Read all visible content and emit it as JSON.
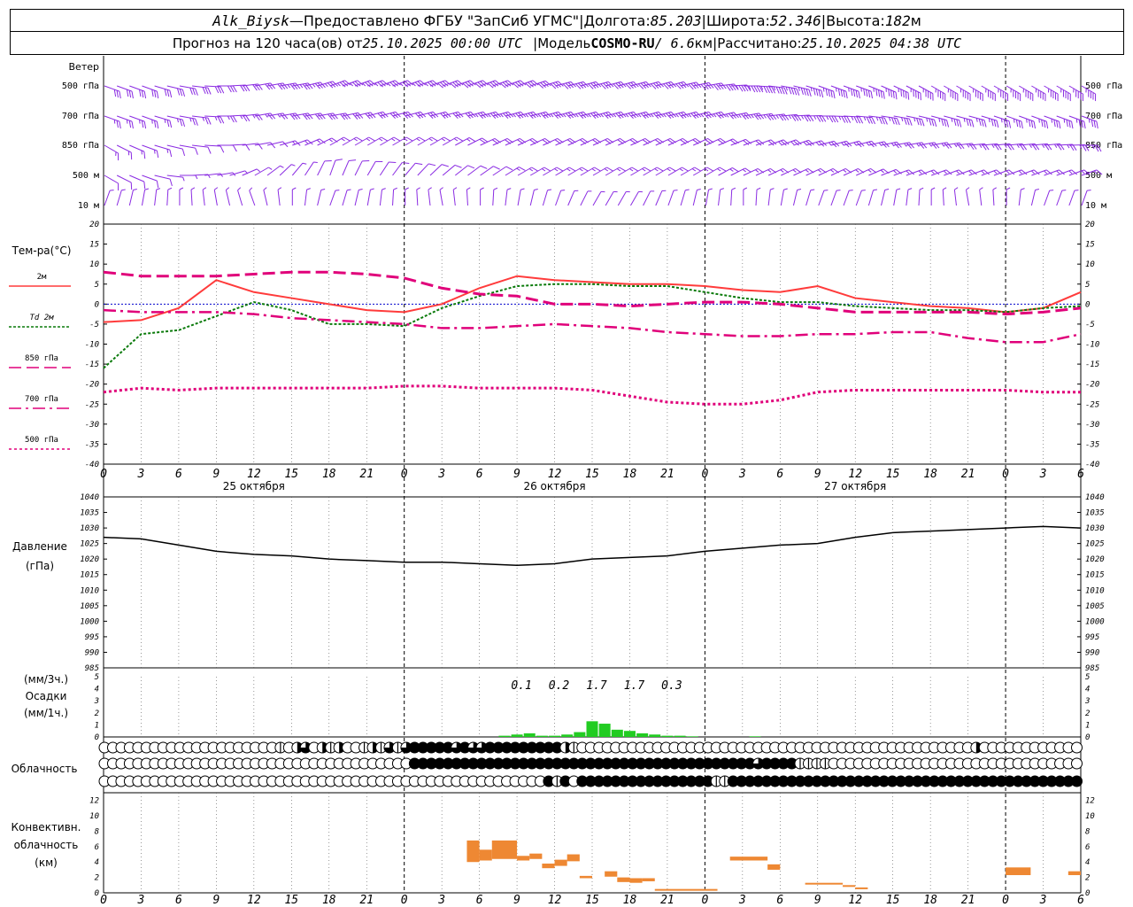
{
  "header": {
    "station": "Alk_Biysk",
    "dash": " — ",
    "provided": "Предоставлено ФГБУ \"ЗапСиб УГМС\"",
    "sep": " | ",
    "lon_label": "Долгота: ",
    "lon": "85.203",
    "lat_label": "Широта: ",
    "lat": "52.346",
    "alt_label": "Высота: ",
    "alt": "182",
    "alt_unit": "м",
    "forecast_label": "Прогноз на 120 часа(ов) от ",
    "forecast_start": "25.10.2025 00:00 UTC",
    "model_label": "Модель ",
    "model": "COSMO-RU",
    "model_res": " / 6.6",
    "model_res_unit": "км",
    "calc_label": "Рассчитано: ",
    "calc_time": "25.10.2025 04:38 UTC"
  },
  "colors": {
    "wind": "#8a2be2",
    "t2m": "#ff3b3b",
    "td2m": "#0a7a0a",
    "t850": "#e0007a",
    "t700": "#e0007a",
    "t500": "#e0007a",
    "zero": "#0000cc",
    "pressure": "#000000",
    "precip": "#22cc22",
    "conv": "#ee8833"
  },
  "panels": {
    "wind": {
      "title": "Ветер",
      "levels": [
        "500 гПа",
        "700 гПа",
        "850 гПа",
        "500 м",
        "10 м"
      ]
    },
    "temp": {
      "title": "Тем-ра(°C)",
      "legend": [
        "2м",
        "Td 2м",
        "850 гПа",
        "700 гПа",
        "500 гПа"
      ],
      "yticks": [
        "20",
        "15",
        "10",
        "5",
        "0",
        "-5",
        "-10",
        "-15",
        "-20",
        "-25",
        "-30",
        "-35",
        "-40"
      ]
    },
    "pressure": {
      "title1": "Давление",
      "title2": "(гПа)",
      "yticks": [
        "1040",
        "1035",
        "1030",
        "1025",
        "1020",
        "1015",
        "1010",
        "1005",
        "1000",
        "995",
        "990",
        "985"
      ]
    },
    "precip": {
      "title1": "(мм/3ч.)",
      "title2": "Осадки",
      "title3": "(мм/1ч.)",
      "yticks": [
        "5",
        "4",
        "3",
        "2",
        "1",
        "0"
      ],
      "sums": [
        "0.1",
        "0.2",
        "1.7",
        "1.7",
        "0.3"
      ]
    },
    "cloud": {
      "title": "Облачность"
    },
    "conv": {
      "title1": "Конвективн.",
      "title2": "облачность",
      "title3": "(км)",
      "yticks": [
        "12",
        "10",
        "8",
        "6",
        "4",
        "2",
        "0"
      ]
    },
    "hour_ticks": [
      "0",
      "3",
      "6",
      "9",
      "12",
      "15",
      "18",
      "21",
      "0",
      "3",
      "6",
      "9",
      "12",
      "15",
      "18",
      "21",
      "0",
      "3",
      "6",
      "9",
      "12",
      "15",
      "18",
      "21",
      "0",
      "3",
      "6"
    ],
    "dates": [
      "25 октября",
      "26 октября",
      "27 октября"
    ]
  },
  "chart_data": [
    {
      "type": "line",
      "title": "Тем-ра(°C)",
      "ylim": [
        -40,
        20
      ],
      "x_hours": [
        0,
        3,
        6,
        9,
        12,
        15,
        18,
        21,
        24,
        27,
        30,
        33,
        36,
        39,
        42,
        45,
        48,
        51,
        54,
        57,
        60,
        63,
        66,
        69,
        72,
        75,
        78
      ],
      "series": [
        {
          "name": "2м",
          "values": [
            -4.5,
            -4,
            -1,
            6,
            3,
            1.5,
            0,
            -1.5,
            -2,
            0,
            4,
            7,
            6,
            5.5,
            5,
            5,
            4.5,
            3.5,
            3,
            4.5,
            1.5,
            0.5,
            -0.5,
            -1,
            -2,
            -1,
            3
          ]
        },
        {
          "name": "Td 2м",
          "values": [
            -16,
            -7.5,
            -6.5,
            -3,
            0.5,
            -1.5,
            -5,
            -5,
            -5.5,
            -1,
            2,
            4.5,
            5,
            5,
            4.5,
            4.5,
            3,
            1.5,
            0.5,
            0.5,
            -0.5,
            -1,
            -1.5,
            -1.5,
            -2,
            -1,
            -0.5
          ]
        },
        {
          "name": "850 гПа",
          "values": [
            8,
            7,
            7,
            7,
            7.5,
            8,
            8,
            7.5,
            6.5,
            4,
            2.5,
            2,
            0,
            0,
            -0.5,
            0,
            0.5,
            0.5,
            0,
            -1,
            -2,
            -2,
            -2,
            -2,
            -2.5,
            -2,
            -1
          ]
        },
        {
          "name": "700 гПа",
          "values": [
            -1.5,
            -2,
            -2,
            -2,
            -2.5,
            -3.5,
            -4,
            -4.5,
            -5,
            -6,
            -6,
            -5.5,
            -5,
            -5.5,
            -6,
            -7,
            -7.5,
            -8,
            -8,
            -7.5,
            -7.5,
            -7,
            -7,
            -8.5,
            -9.5,
            -9.5,
            -7.5
          ]
        },
        {
          "name": "500 гПа",
          "values": [
            -22,
            -21,
            -21.5,
            -21,
            -21,
            -21,
            -21,
            -21,
            -20.5,
            -20.5,
            -21,
            -21,
            -21,
            -21.5,
            -23,
            -24.5,
            -25,
            -25,
            -24,
            -22,
            -21.5,
            -21.5,
            -21.5,
            -21.5,
            -21.5,
            -22,
            -22
          ]
        }
      ]
    },
    {
      "type": "line",
      "title": "Давление",
      "ylabel": "(гПа)",
      "ylim": [
        985,
        1040
      ],
      "x_hours": [
        0,
        3,
        6,
        9,
        12,
        15,
        18,
        21,
        24,
        27,
        30,
        33,
        36,
        39,
        42,
        45,
        48,
        51,
        54,
        57,
        60,
        63,
        66,
        69,
        72,
        75,
        78
      ],
      "series": [
        {
          "name": "Давление",
          "values": [
            1027,
            1026.5,
            1024.5,
            1022.5,
            1021.5,
            1021,
            1020,
            1019.5,
            1019,
            1019,
            1018.5,
            1018,
            1018.5,
            1020,
            1020.5,
            1021,
            1022.5,
            1023.5,
            1024.5,
            1025,
            1027,
            1028.5,
            1029,
            1029.5,
            1030,
            1030.5,
            1030
          ]
        }
      ]
    },
    {
      "type": "bar",
      "title": "Осадки",
      "ylabel": "(мм/1ч.)",
      "ylim": [
        0,
        5
      ],
      "x_hours": [
        32,
        33,
        34,
        35,
        36,
        37,
        38,
        39,
        40,
        41,
        42,
        43,
        44,
        45,
        46,
        47,
        52
      ],
      "values": [
        0.1,
        0.2,
        0.3,
        0.1,
        0.1,
        0.2,
        0.4,
        1.3,
        1.1,
        0.6,
        0.5,
        0.3,
        0.2,
        0.1,
        0.1,
        0.05,
        0.05
      ]
    },
    {
      "type": "bar",
      "title": "Конвективн. облачность",
      "ylabel": "(км)",
      "ylim": [
        0,
        12
      ],
      "segments": [
        {
          "x0": 29,
          "x1": 30,
          "base": 4,
          "top": 6.8
        },
        {
          "x0": 30,
          "x1": 31,
          "base": 4.2,
          "top": 5.6
        },
        {
          "x0": 31,
          "x1": 33,
          "base": 4.4,
          "top": 6.8
        },
        {
          "x0": 33,
          "x1": 34,
          "base": 4.2,
          "top": 4.8
        },
        {
          "x0": 34,
          "x1": 35,
          "base": 4.4,
          "top": 5.1
        },
        {
          "x0": 35,
          "x1": 36,
          "base": 3.2,
          "top": 3.8
        },
        {
          "x0": 36,
          "x1": 37,
          "base": 3.5,
          "top": 4.3
        },
        {
          "x0": 37,
          "x1": 38,
          "base": 4.1,
          "top": 5
        },
        {
          "x0": 38,
          "x1": 39,
          "base": 1.9,
          "top": 2.2
        },
        {
          "x0": 40,
          "x1": 41,
          "base": 2.1,
          "top": 2.8
        },
        {
          "x0": 41,
          "x1": 42,
          "base": 1.4,
          "top": 2
        },
        {
          "x0": 42,
          "x1": 43,
          "base": 1.3,
          "top": 1.9
        },
        {
          "x0": 43,
          "x1": 44,
          "base": 1.5,
          "top": 1.9
        },
        {
          "x0": 44,
          "x1": 49,
          "base": 0.3,
          "top": 0.5
        },
        {
          "x0": 50,
          "x1": 53,
          "base": 4.2,
          "top": 4.7
        },
        {
          "x0": 53,
          "x1": 54,
          "base": 3,
          "top": 3.7
        },
        {
          "x0": 56,
          "x1": 59,
          "base": 1.1,
          "top": 1.3
        },
        {
          "x0": 59,
          "x1": 60,
          "base": 0.8,
          "top": 1
        },
        {
          "x0": 60,
          "x1": 61,
          "base": 0.5,
          "top": 0.7
        },
        {
          "x0": 72,
          "x1": 74,
          "base": 2.3,
          "top": 3.3
        },
        {
          "x0": 77,
          "x1": 78,
          "base": 2.3,
          "top": 2.8
        }
      ]
    },
    {
      "type": "table",
      "title": "Облачность",
      "note": "cover codes 0..4 per hour (0=clear, 4=overcast), rows: upper, middle, lower",
      "rows": [
        "000000000000000000000102302120012131344444343344444444421000000000000000000000000000000000000000000000002000000000000",
        "000000000000000000000000000000000000044444444444444444444444444444444444444444344441111000000000000000000000000000000",
        "000000000000000000000000000000000000000000000000000004140444444444444444411444444444444444444444444444444444444444444"
      ]
    },
    {
      "type": "table",
      "title": "Ветер",
      "note": "wind direction (deg, from) and speed (kt) per level every 3 h",
      "levels": [
        "500 гПа",
        "700 гПа",
        "850 гПа",
        "500 м",
        "10 м"
      ],
      "x_hours": [
        0,
        3,
        6,
        9,
        12,
        15,
        18,
        21,
        24,
        27,
        30,
        33,
        36,
        39,
        42,
        45,
        48,
        51,
        54,
        57,
        60,
        63,
        66,
        69,
        72,
        75,
        78
      ],
      "dir": [
        [
          290,
          290,
          280,
          270,
          260,
          260,
          250,
          250,
          250,
          250,
          250,
          250,
          255,
          255,
          255,
          255,
          260,
          270,
          280,
          290,
          290,
          295,
          300,
          300,
          300,
          300,
          300
        ],
        [
          290,
          290,
          280,
          270,
          260,
          260,
          260,
          255,
          255,
          255,
          255,
          255,
          255,
          255,
          255,
          255,
          255,
          260,
          265,
          270,
          275,
          280,
          285,
          285,
          290,
          290,
          290
        ],
        [
          300,
          290,
          280,
          270,
          260,
          250,
          240,
          240,
          240,
          240,
          245,
          245,
          245,
          245,
          245,
          245,
          245,
          250,
          250,
          255,
          255,
          260,
          260,
          265,
          265,
          265,
          270
        ],
        [
          300,
          290,
          270,
          260,
          240,
          220,
          200,
          210,
          220,
          230,
          235,
          240,
          240,
          240,
          240,
          240,
          240,
          245,
          245,
          245,
          245,
          250,
          250,
          250,
          250,
          250,
          250
        ],
        [
          200,
          190,
          180,
          170,
          160,
          180,
          200,
          190,
          180,
          170,
          180,
          190,
          200,
          210,
          210,
          200,
          190,
          180,
          190,
          200,
          200,
          190,
          180,
          170,
          180,
          200,
          200
        ]
      ],
      "speed": [
        [
          30,
          30,
          30,
          30,
          30,
          35,
          35,
          35,
          35,
          40,
          40,
          40,
          40,
          40,
          40,
          40,
          40,
          45,
          45,
          45,
          45,
          45,
          45,
          45,
          45,
          45,
          45
        ],
        [
          25,
          25,
          25,
          25,
          25,
          30,
          30,
          30,
          30,
          30,
          35,
          35,
          35,
          35,
          35,
          35,
          35,
          35,
          35,
          35,
          35,
          35,
          35,
          35,
          35,
          35,
          35
        ],
        [
          15,
          15,
          10,
          10,
          10,
          15,
          15,
          15,
          15,
          15,
          20,
          20,
          20,
          20,
          20,
          20,
          20,
          20,
          25,
          25,
          25,
          25,
          25,
          25,
          25,
          25,
          25
        ],
        [
          10,
          10,
          5,
          5,
          5,
          5,
          10,
          10,
          10,
          10,
          10,
          15,
          15,
          15,
          15,
          15,
          15,
          15,
          15,
          15,
          15,
          15,
          15,
          15,
          15,
          15,
          15
        ],
        [
          5,
          5,
          5,
          5,
          5,
          5,
          5,
          5,
          5,
          5,
          5,
          5,
          5,
          5,
          5,
          5,
          5,
          5,
          5,
          5,
          5,
          5,
          5,
          5,
          5,
          5,
          5
        ]
      ]
    }
  ]
}
